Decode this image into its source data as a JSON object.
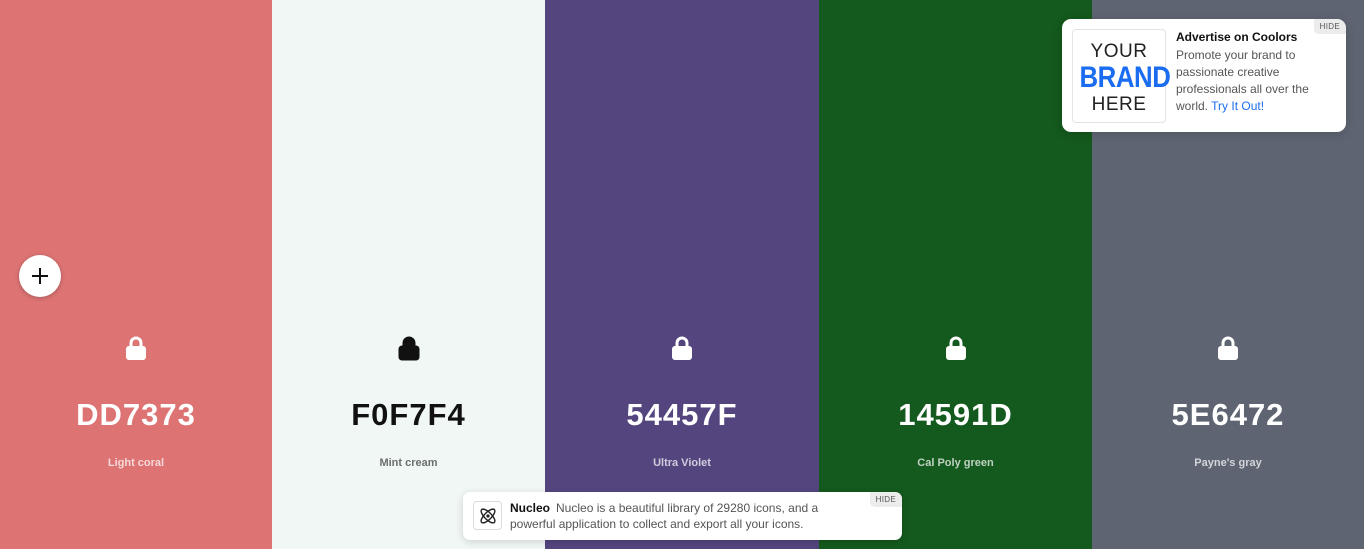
{
  "palette": [
    {
      "hex": "DD7373",
      "name": "Light coral",
      "color": "#DD7373",
      "tone": "dark",
      "lock_icon": "lock-icon"
    },
    {
      "hex": "F0F7F4",
      "name": "Mint cream",
      "color": "#F0F7F4",
      "tone": "light",
      "lock_icon": "lock-icon"
    },
    {
      "hex": "54457F",
      "name": "Ultra Violet",
      "color": "#54457F",
      "tone": "dark",
      "lock_icon": "lock-icon"
    },
    {
      "hex": "14591D",
      "name": "Cal Poly green",
      "color": "#14591D",
      "tone": "dark",
      "lock_icon": "lock-icon"
    },
    {
      "hex": "5E6472",
      "name": "Payne's gray",
      "color": "#5E6472",
      "tone": "dark",
      "lock_icon": "lock-icon"
    }
  ],
  "add_button": {
    "icon": "plus-icon"
  },
  "ad": {
    "logo_line1": "YOUR",
    "logo_line2": "BRAND",
    "logo_line3": "HERE",
    "title": "Advertise on Coolors",
    "body": "Promote your brand to passionate creative professionals all over the world.",
    "link": "Try It Out!",
    "hide_label": "HIDE"
  },
  "nucleo": {
    "icon": "atom-icon",
    "title": "Nucleo",
    "body": "Nucleo is a beautiful library of 29280 icons, and a powerful application to collect and export all your icons.",
    "hide_label": "HIDE"
  }
}
